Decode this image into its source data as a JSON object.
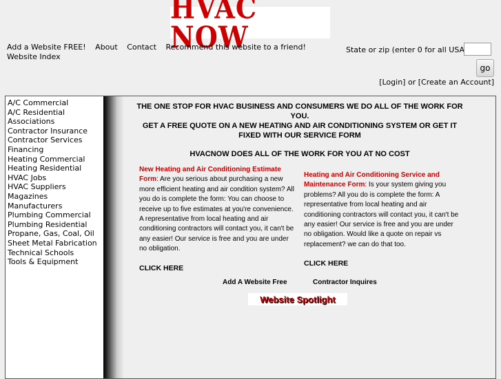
{
  "logo": {
    "text": "HVAC NOW"
  },
  "topnav": {
    "items": [
      "Add a Website FREE!",
      "About",
      "Contact",
      "Recommend this website to a friend!",
      "Website Index"
    ]
  },
  "search": {
    "label": "State or zip (enter 0 for all USA):",
    "value": "",
    "go_label": "go"
  },
  "account": {
    "login": "[Login]",
    "or": "or",
    "create": "[Create an Account]"
  },
  "sidebar": {
    "items": [
      "A/C Commercial",
      "A/C Residential",
      "Associations",
      "Contractor Insurance",
      "Contractor Services",
      "Financing",
      "Heating Commercial",
      "Heating Residential",
      "HVAC Jobs",
      "HVAC Suppliers",
      "Magazines",
      "Manufacturers",
      "Plumbing Commercial",
      "Plumbing Residential",
      "Propane, Gas, Coal, Oil",
      "Sheet Metal Fabrication",
      "Technical Schools",
      "Tools & Equipment"
    ]
  },
  "main": {
    "headline1": "THE ONE STOP FOR HVAC BUSINESS AND CONSUMERS WE DO ALL OF THE WORK FOR YOU.",
    "headline2": "GET A FREE QUOTE ON A NEW HEATING AND AIR CONDITIONING SYSTEM OR GET IT FIXED WITH OUR SERVICE FORM",
    "headline3": "HVACNOW DOES ALL OF THE WORK FOR YOU AT NO COST",
    "left": {
      "title": "New Heating and Air Conditioning Estimate Form",
      "body": ": Are you serious about purchasing a new more efficient heating and air condition system? All you do is complete the form: You can choose to receive up to five estimates at you're convenience. A representative from local heating and air conditioning contractors will contact you, it can't be any easier! Our service is free and you are under no obligation.",
      "click": "CLICK HERE"
    },
    "right": {
      "title": "Heating and Air Conditioning Service and Maintenance Form",
      "body": ": Is your system giving you problems? All you do is complete the form: A representative from local heating and air conditioning contractors will contact you, it can't be any easier! Our service is free and you are under no obligation. Would like a quote on repair vs replacement? we can do that too.",
      "click": "CLICK HERE"
    },
    "footer": {
      "add": "Add A Website Free",
      "inquires": "Contractor Inquires"
    },
    "spotlight": "Website Spotlight"
  }
}
